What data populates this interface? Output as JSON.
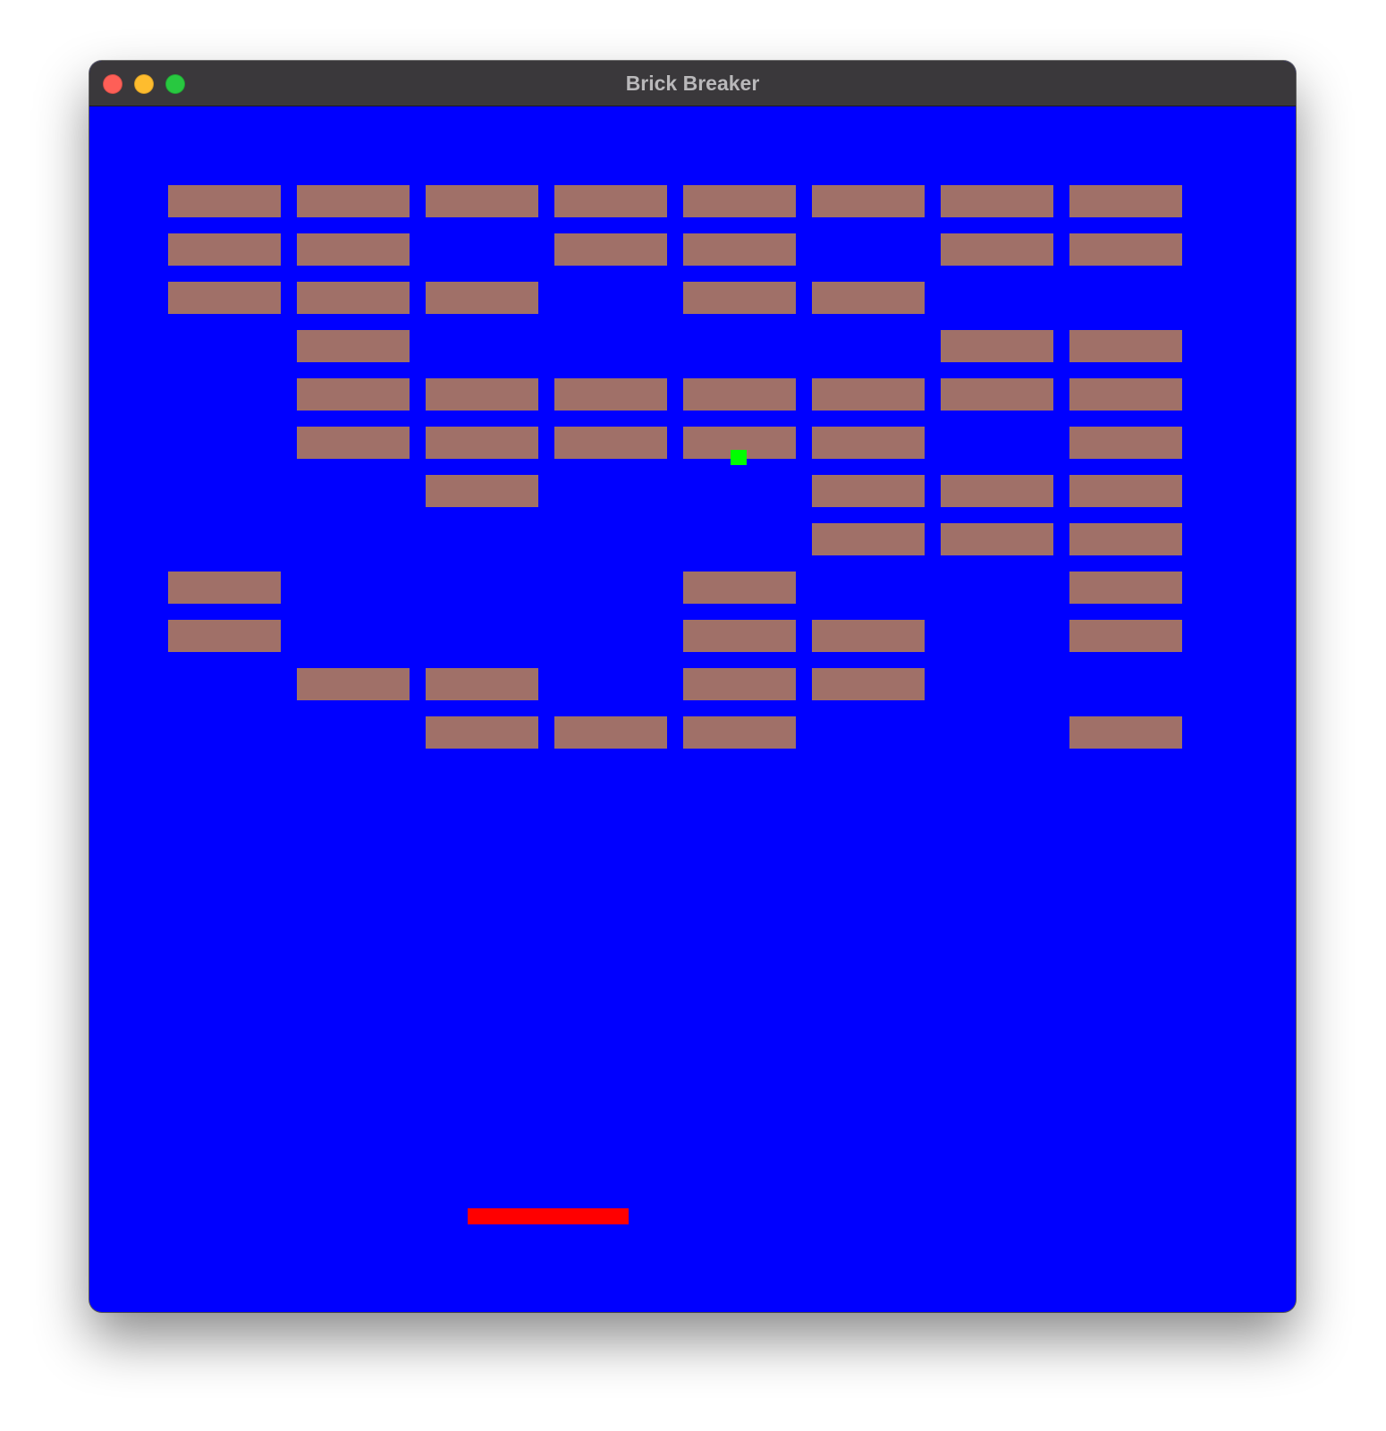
{
  "window": {
    "title": "Brick Breaker",
    "background_color": "#0000ff",
    "titlebar_color": "#3a383b",
    "traffic_lights": [
      {
        "name": "close-button",
        "icon": "close-icon",
        "color": "#fe5f57"
      },
      {
        "name": "minimize-button",
        "icon": "minimize-icon",
        "color": "#febc2e"
      },
      {
        "name": "zoom-button",
        "icon": "zoom-icon",
        "color": "#28c840"
      }
    ]
  },
  "game": {
    "brick_color": "#a07068",
    "ball_color": "#00ff00",
    "paddle_color": "#ff0000",
    "grid": {
      "rows": 12,
      "columns": 8,
      "bricks": [
        [
          1,
          1,
          1,
          1,
          1,
          1,
          1,
          1
        ],
        [
          1,
          1,
          0,
          1,
          1,
          0,
          1,
          1
        ],
        [
          1,
          1,
          1,
          0,
          1,
          1,
          0,
          0
        ],
        [
          0,
          1,
          0,
          0,
          0,
          0,
          1,
          1
        ],
        [
          0,
          1,
          1,
          1,
          1,
          1,
          1,
          1
        ],
        [
          0,
          1,
          1,
          1,
          1,
          1,
          0,
          1
        ],
        [
          0,
          0,
          1,
          0,
          0,
          1,
          1,
          1
        ],
        [
          0,
          0,
          0,
          0,
          0,
          1,
          1,
          1
        ],
        [
          1,
          0,
          0,
          0,
          1,
          0,
          0,
          1
        ],
        [
          1,
          0,
          0,
          0,
          1,
          1,
          0,
          1
        ],
        [
          0,
          1,
          1,
          0,
          1,
          1,
          0,
          0
        ],
        [
          0,
          0,
          1,
          1,
          1,
          0,
          0,
          1
        ]
      ]
    }
  }
}
